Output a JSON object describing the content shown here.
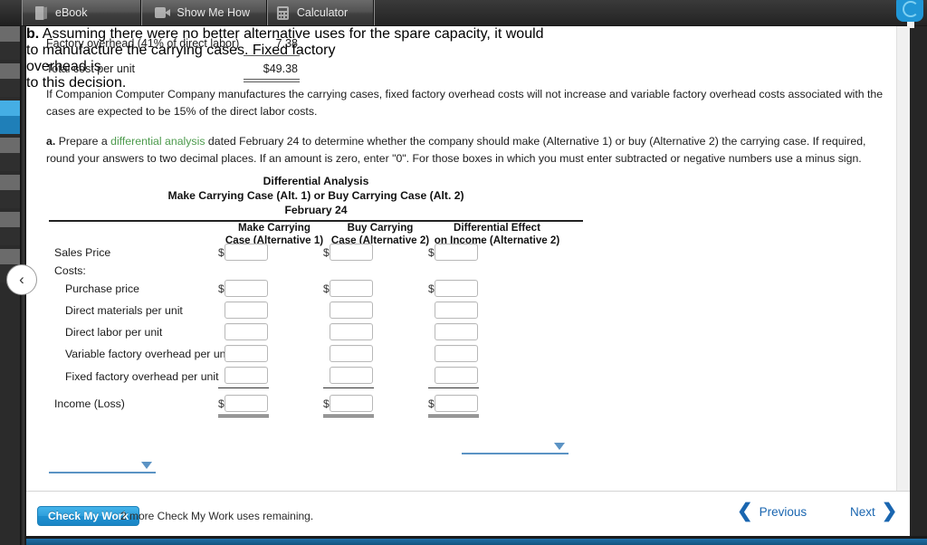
{
  "tabs": [
    {
      "label": "eBook",
      "icon": "book-icon"
    },
    {
      "label": "Show Me How",
      "icon": "video-icon"
    },
    {
      "label": "Calculator",
      "icon": "calculator-icon"
    }
  ],
  "help": {
    "icon": "help-chat-icon"
  },
  "sidebar": {
    "collapse_label": "‹",
    "bands": [
      {
        "color": "#6b6b6b"
      },
      {
        "color": "#2f2f2f"
      },
      {
        "color": "#6b6b6b"
      },
      {
        "color": "#2f2f2f"
      },
      {
        "color": "#45aee4"
      },
      {
        "color": "#1f7fb8"
      },
      {
        "color": "#6b6b6b"
      },
      {
        "color": "#2f2f2f"
      },
      {
        "color": "#6b6b6b"
      },
      {
        "color": "#2f2f2f"
      },
      {
        "color": "#6b6b6b"
      },
      {
        "color": "#2f2f2f"
      },
      {
        "color": "#6b6b6b"
      },
      {
        "color": "#2f2f2f"
      }
    ]
  },
  "cost_summary": {
    "overhead_label": "Factory overhead (41% of direct labor)",
    "overhead_value": "7.38",
    "total_label": "Total cost per unit",
    "total_value": "$49.38"
  },
  "intro_paragraph": "If Companion Computer Company manufactures the carrying cases, fixed factory overhead costs will not increase and variable factory overhead costs associated with the cases are expected to be 15% of the direct labor costs.",
  "part_a": {
    "marker": "a.",
    "text_before_link": "Prepare a ",
    "link_text": "differential analysis",
    "text_after_link": " dated February 24 to determine whether the company should make (Alternative 1) or buy (Alternative 2) the carrying case. If required, round your answers to two decimal places. If an amount is zero, enter \"0\". For those boxes in which you must enter subtracted or negative numbers use a minus sign."
  },
  "table": {
    "title_line1": "Differential Analysis",
    "title_line2": "Make Carrying Case (Alt. 1) or Buy Carrying Case (Alt. 2)",
    "title_line3": "February 24",
    "columns": [
      {
        "line1": "Make Carrying",
        "line2": "Case (Alternative 1)"
      },
      {
        "line1": "Buy Carrying",
        "line2": "Case (Alternative 2)"
      },
      {
        "line1": "Differential Effect",
        "line2": "on Income (Alternative 2)"
      }
    ],
    "rows": [
      {
        "label": "Sales Price",
        "indent": 0,
        "dollar": true,
        "values": [
          "",
          "",
          ""
        ]
      },
      {
        "label": "Costs:",
        "indent": 0,
        "dollar": false,
        "values": [
          null,
          null,
          null
        ]
      },
      {
        "label": "Purchase price",
        "indent": 1,
        "dollar": true,
        "values": [
          "",
          "",
          ""
        ]
      },
      {
        "label": "Direct materials per unit",
        "indent": 1,
        "dollar": false,
        "values": [
          "",
          "",
          ""
        ]
      },
      {
        "label": "Direct labor per unit",
        "indent": 1,
        "dollar": false,
        "values": [
          "",
          "",
          ""
        ]
      },
      {
        "label": "Variable factory overhead per unit",
        "indent": 1,
        "dollar": false,
        "values": [
          "",
          "",
          ""
        ]
      },
      {
        "label": "Fixed factory overhead per unit",
        "indent": 1,
        "dollar": false,
        "values": [
          "",
          "",
          ""
        ]
      },
      {
        "label": "Income (Loss)",
        "indent": 0,
        "dollar": true,
        "values": [
          "",
          "",
          ""
        ]
      }
    ],
    "dollar_sign": "$"
  },
  "part_b": {
    "marker": "b.",
    "text1": "Assuming there were no better alternative uses for the spare capacity, it would",
    "dropdown1_value": "",
    "text2": "to manufacture the carrying cases. Fixed factory overhead is",
    "dropdown2_value": "",
    "text3": "to this decision."
  },
  "footer": {
    "check_my_work": "Check My Work",
    "uses_remaining": "2 more Check My Work uses remaining.",
    "previous": "Previous",
    "next": "Next",
    "prev_chevron": "❮",
    "next_chevron": "❯"
  },
  "colors": {
    "link_green": "#4c9a4c",
    "dropdown_blue": "#5b93c4",
    "accent_blue": "#1a86c6",
    "nav_blue": "#1a66b0"
  }
}
